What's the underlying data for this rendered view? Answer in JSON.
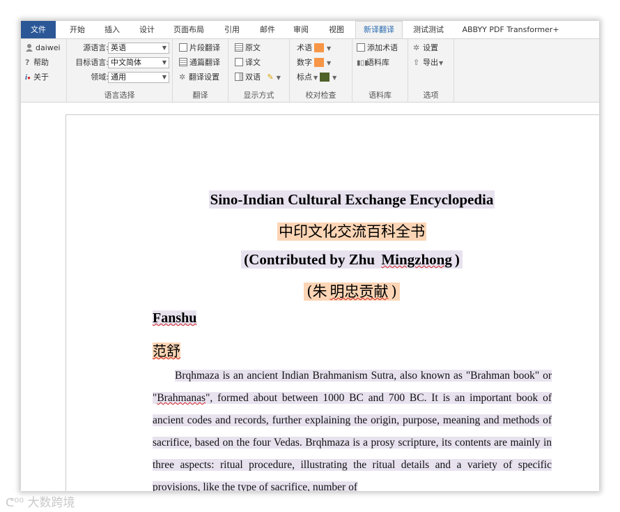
{
  "tabs": [
    "文件",
    "开始",
    "插入",
    "设计",
    "页面布局",
    "引用",
    "邮件",
    "审阅",
    "视图",
    "新译翻译",
    "测试测试",
    "ABBYY PDF Transformer+"
  ],
  "user": {
    "name": "daiwei",
    "help": "帮助",
    "about": "关于"
  },
  "language": {
    "source_label": "源语言:",
    "source_value": "英语",
    "target_label": "目标语言:",
    "target_value": "中文简体",
    "domain_label": "领域:",
    "domain_value": "通用",
    "group": "语言选择"
  },
  "translate": {
    "segment": "片段翻译",
    "full": "通篇翻译",
    "settings": "翻译设置",
    "group": "翻译"
  },
  "display": {
    "original": "原文",
    "translation": "译文",
    "bilingual": "双语",
    "group": "显示方式"
  },
  "proof": {
    "term": "术语",
    "number": "数字",
    "punct": "标点",
    "group": "校对检查",
    "term_color": "#f79646",
    "number_color": "#f79646",
    "punct_color": "#4f6228"
  },
  "corpus": {
    "add_term": "添加术语",
    "library": "语料库",
    "group": "语料库"
  },
  "options": {
    "settings": "设置",
    "export": "导出",
    "group": "选项"
  },
  "document": {
    "title_en": "Sino-Indian Cultural Exchange Encyclopedia",
    "title_zh": "中印文化交流百科全书",
    "contrib_en_pre": "(Contributed by Zhu ",
    "contrib_en_name": "Mingzhong",
    "contrib_en_post": ")",
    "contrib_zh_pre": "(朱",
    "contrib_zh_name": "明忠贡献",
    "contrib_zh_post": ")",
    "heading_en": "Fanshu",
    "heading_zh": "范舒",
    "para_1": "Brqhmaza is an ancient Indian Brahmanism Sutra, also known as \"Brahman book\" or \"",
    "para_link": "Brahmanas",
    "para_2": "\", formed about between 1000 BC and 700 BC. It is an important book of ancient codes and records, further explaining the origin, purpose, meaning and methods of sacrifice, based on the four Vedas. Brqhmaza is a prosy scripture, its contents are mainly in three aspects: ritual procedure, illustrating the ritual details and a variety of specific provisions, like the type of sacrifice, number of"
  },
  "watermark": "大数跨境"
}
